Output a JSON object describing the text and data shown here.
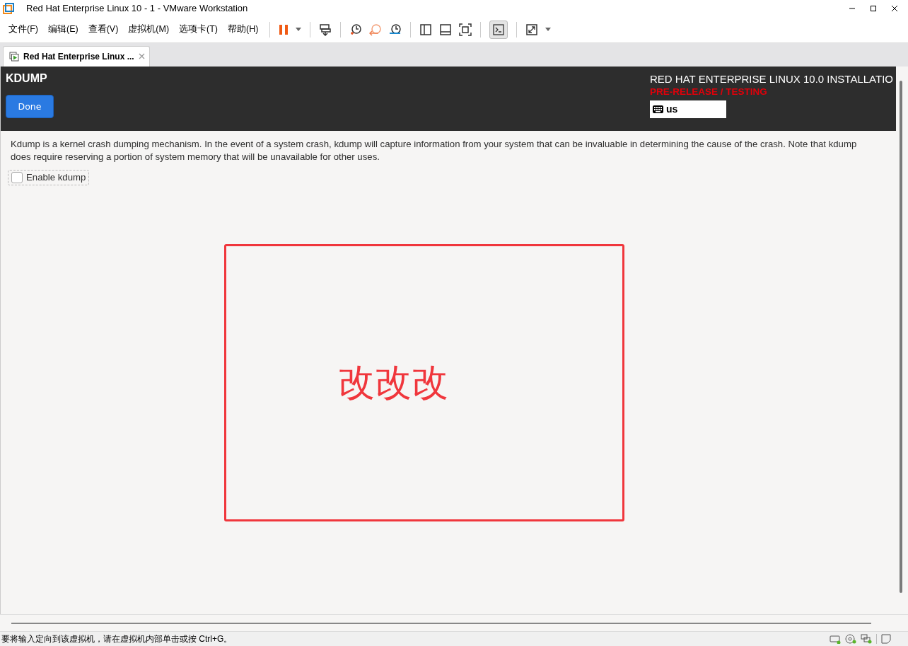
{
  "window": {
    "title": "Red Hat Enterprise Linux 10 - 1 - VMware Workstation"
  },
  "menu": [
    "文件(F)",
    "编辑(E)",
    "查看(V)",
    "虚拟机(M)",
    "选项卡(T)",
    "帮助(H)"
  ],
  "tabs": [
    {
      "label": "Red Hat Enterprise Linux ...",
      "selected": true
    }
  ],
  "installer": {
    "heading": "KDUMP",
    "done_button": "Done",
    "product_title": "RED HAT ENTERPRISE LINUX 10.0 INSTALLATIO",
    "prerelease": "PRE-RELEASE / TESTING",
    "keyboard_layout": "us",
    "description": [
      "Kdump is a kernel crash dumping mechanism. In the event of a system crash, kdump will capture information from your system that can be invaluable in determining the cause of the crash. Note that kdump",
      "does require reserving a portion of system memory that will be unavailable for other uses."
    ],
    "enable_checkbox": {
      "label": "Enable kdump",
      "checked": false
    }
  },
  "annotation": {
    "text": "改改改"
  },
  "status_bar": {
    "text": "要将输入定向到该虚拟机，请在虚拟机内部单击或按 Ctrl+G。"
  }
}
